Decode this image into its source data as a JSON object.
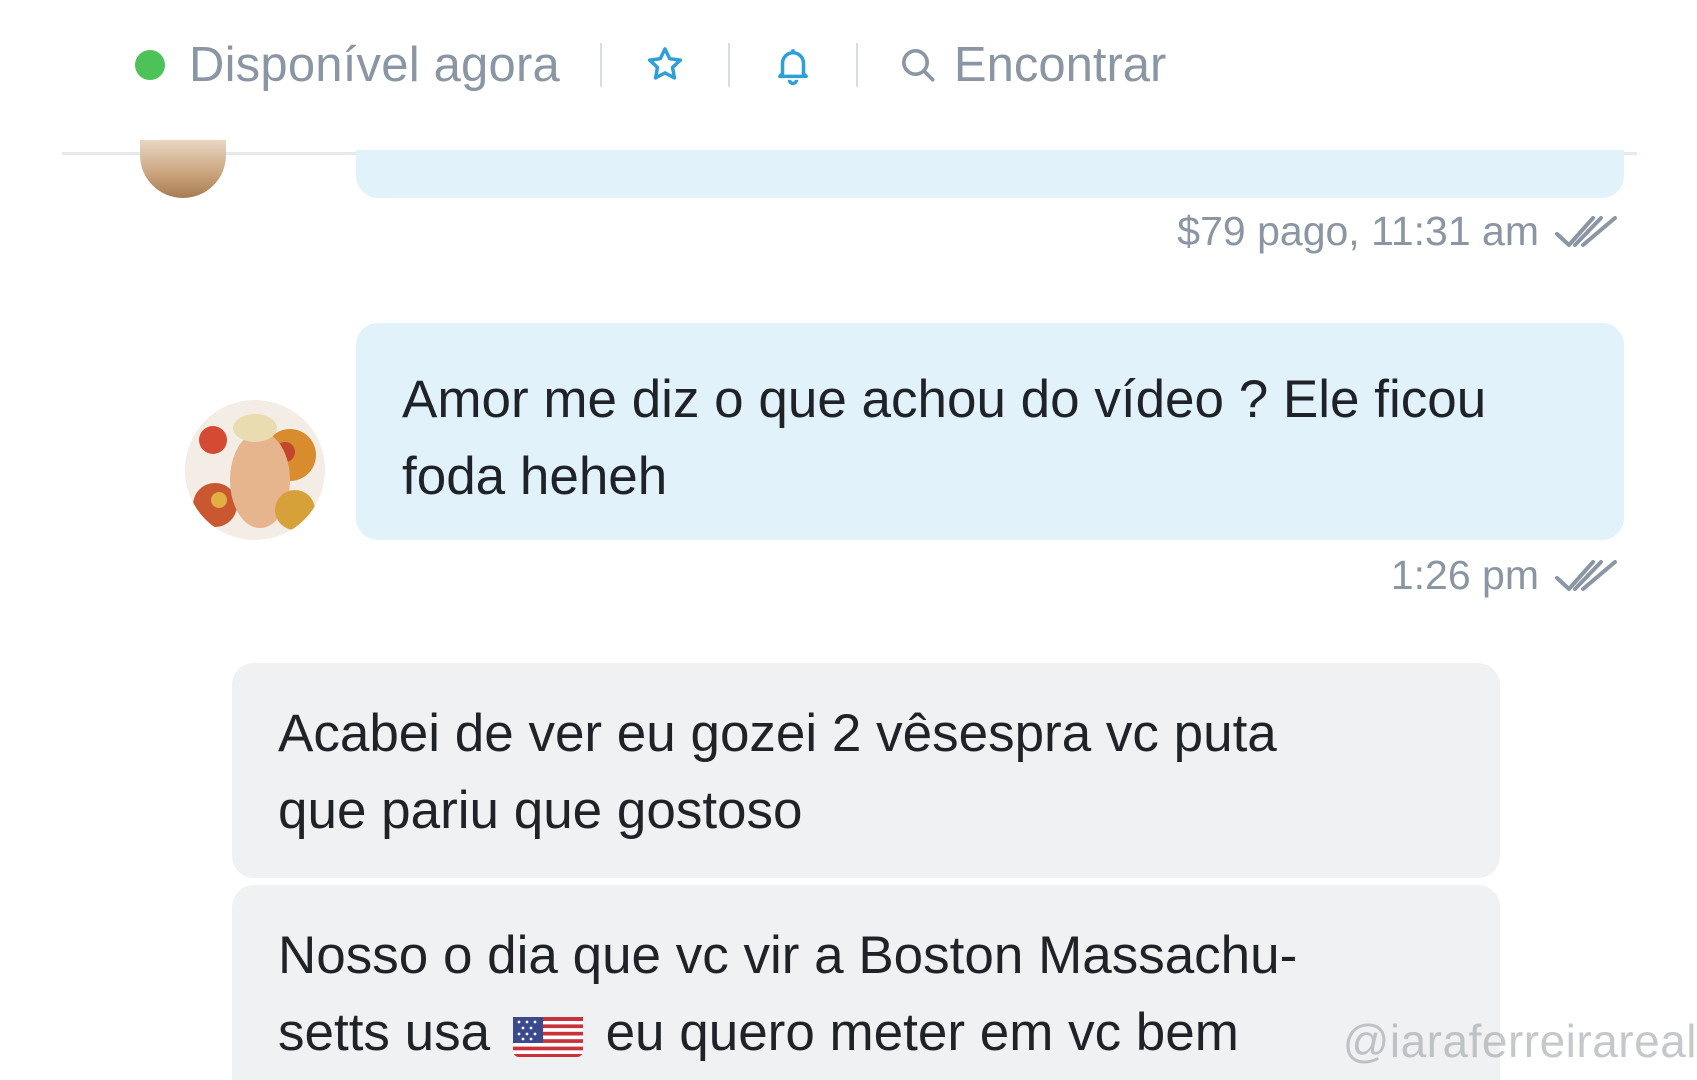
{
  "header": {
    "status_label": "Disponível agora",
    "status_color": "#4cc258",
    "icons": [
      "star-icon",
      "bell-icon",
      "search-icon"
    ],
    "find_label": "Encontrar"
  },
  "messages": {
    "paid_meta": "$79 pago, 11:31 am",
    "outgoing": {
      "line1": "Amor me diz o que achou do vídeo ? Ele ficou",
      "line2": "foda heheh",
      "time": "1:26 pm"
    },
    "incoming": [
      {
        "line1": "Acabei de ver eu gozei 2 vêsespra vc puta",
        "line2": "que pariu que gostoso"
      },
      {
        "line1": "Nosso o dia que vc vir a Boston Massachu-",
        "line2_before": "setts usa",
        "line2_after": "eu quero meter em vc bem"
      }
    ]
  },
  "watermark": "@iaraferreirareal",
  "colors": {
    "outgoing_bubble": "#e1f2fb",
    "incoming_bubble": "#f0f1f3",
    "accent_blue": "#2f9fd8",
    "muted_text": "#8a96a3"
  }
}
